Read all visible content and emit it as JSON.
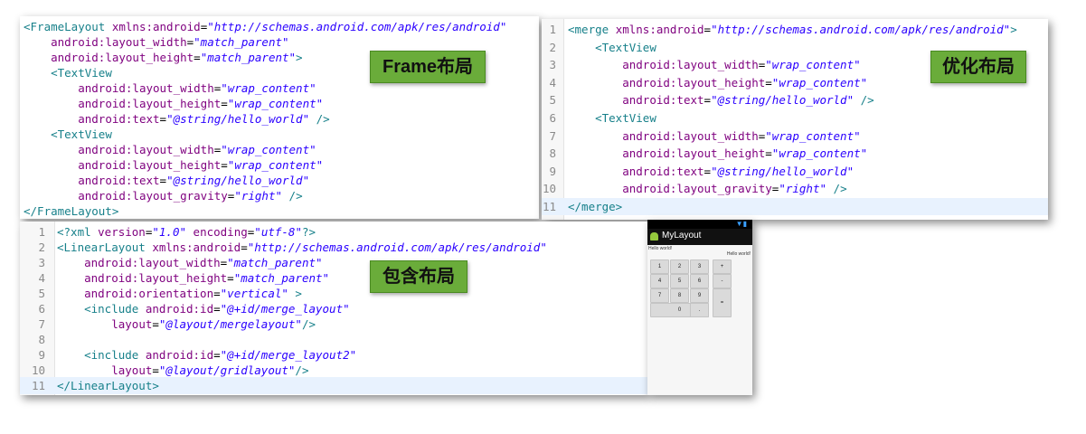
{
  "frame_panel": {
    "label": "Frame布局",
    "lines": [
      [
        [
          "tag",
          "<FrameLayout "
        ],
        [
          "attr",
          "xmlns:android"
        ],
        [
          "plain",
          "="
        ],
        [
          "val",
          "\"http://schemas.android.com/apk/res/android\""
        ]
      ],
      [
        [
          "plain",
          "    "
        ],
        [
          "attr",
          "android:layout_width"
        ],
        [
          "plain",
          "="
        ],
        [
          "val",
          "\"match_parent\""
        ]
      ],
      [
        [
          "plain",
          "    "
        ],
        [
          "attr",
          "android:layout_height"
        ],
        [
          "plain",
          "="
        ],
        [
          "val",
          "\"match_parent\""
        ],
        [
          "tag",
          ">"
        ]
      ],
      [
        [
          "plain",
          "    "
        ],
        [
          "tag",
          "<TextView"
        ]
      ],
      [
        [
          "plain",
          "        "
        ],
        [
          "attr",
          "android:layout_width"
        ],
        [
          "plain",
          "="
        ],
        [
          "val",
          "\"wrap_content\""
        ]
      ],
      [
        [
          "plain",
          "        "
        ],
        [
          "attr",
          "android:layout_height"
        ],
        [
          "plain",
          "="
        ],
        [
          "val",
          "\"wrap_content\""
        ]
      ],
      [
        [
          "plain",
          "        "
        ],
        [
          "attr",
          "android:text"
        ],
        [
          "plain",
          "="
        ],
        [
          "val",
          "\"@string/hello_world\""
        ],
        [
          "tag",
          " />"
        ]
      ],
      [
        [
          "plain",
          "    "
        ],
        [
          "tag",
          "<TextView"
        ]
      ],
      [
        [
          "plain",
          "        "
        ],
        [
          "attr",
          "android:layout_width"
        ],
        [
          "plain",
          "="
        ],
        [
          "val",
          "\"wrap_content\""
        ]
      ],
      [
        [
          "plain",
          "        "
        ],
        [
          "attr",
          "android:layout_height"
        ],
        [
          "plain",
          "="
        ],
        [
          "val",
          "\"wrap_content\""
        ]
      ],
      [
        [
          "plain",
          "        "
        ],
        [
          "attr",
          "android:text"
        ],
        [
          "plain",
          "="
        ],
        [
          "val",
          "\"@string/hello_world\""
        ]
      ],
      [
        [
          "plain",
          "        "
        ],
        [
          "attr",
          "android:layout_gravity"
        ],
        [
          "plain",
          "="
        ],
        [
          "val",
          "\"right\""
        ],
        [
          "tag",
          " />"
        ]
      ],
      [
        [
          "tag",
          "</FrameLayout>"
        ]
      ]
    ]
  },
  "merge_panel": {
    "label": "优化布局",
    "lines": [
      {
        "n": "1",
        "t": [
          [
            "tag",
            "<merge "
          ],
          [
            "attr",
            "xmlns:android"
          ],
          [
            "plain",
            "="
          ],
          [
            "val",
            "\"http://schemas.android.com/apk/res/android\""
          ],
          [
            "tag",
            ">"
          ]
        ]
      },
      {
        "n": "2",
        "t": [
          [
            "plain",
            "    "
          ],
          [
            "tag",
            "<TextView"
          ]
        ]
      },
      {
        "n": "3",
        "t": [
          [
            "plain",
            "        "
          ],
          [
            "attr",
            "android:layout_width"
          ],
          [
            "plain",
            "="
          ],
          [
            "val",
            "\"wrap_content\""
          ]
        ]
      },
      {
        "n": "4",
        "t": [
          [
            "plain",
            "        "
          ],
          [
            "attr",
            "android:layout_height"
          ],
          [
            "plain",
            "="
          ],
          [
            "val",
            "\"wrap_content\""
          ]
        ]
      },
      {
        "n": "5",
        "t": [
          [
            "plain",
            "        "
          ],
          [
            "attr",
            "android:text"
          ],
          [
            "plain",
            "="
          ],
          [
            "val",
            "\"@string/hello_world\""
          ],
          [
            "tag",
            " />"
          ]
        ]
      },
      {
        "n": "6",
        "t": [
          [
            "plain",
            "    "
          ],
          [
            "tag",
            "<TextView"
          ]
        ]
      },
      {
        "n": "7",
        "t": [
          [
            "plain",
            "        "
          ],
          [
            "attr",
            "android:layout_width"
          ],
          [
            "plain",
            "="
          ],
          [
            "val",
            "\"wrap_content\""
          ]
        ]
      },
      {
        "n": "8",
        "t": [
          [
            "plain",
            "        "
          ],
          [
            "attr",
            "android:layout_height"
          ],
          [
            "plain",
            "="
          ],
          [
            "val",
            "\"wrap_content\""
          ]
        ]
      },
      {
        "n": "9",
        "t": [
          [
            "plain",
            "        "
          ],
          [
            "attr",
            "android:text"
          ],
          [
            "plain",
            "="
          ],
          [
            "val",
            "\"@string/hello_world\""
          ]
        ]
      },
      {
        "n": "10",
        "t": [
          [
            "plain",
            "        "
          ],
          [
            "attr",
            "android:layout_gravity"
          ],
          [
            "plain",
            "="
          ],
          [
            "val",
            "\"right\""
          ],
          [
            "tag",
            " />"
          ]
        ]
      },
      {
        "n": "11",
        "t": [
          [
            "tag",
            "</merge>"
          ]
        ]
      }
    ]
  },
  "include_panel": {
    "label": "包含布局",
    "lines": [
      {
        "n": "1",
        "t": [
          [
            "tag",
            "<?xml "
          ],
          [
            "attr",
            "version"
          ],
          [
            "plain",
            "="
          ],
          [
            "val",
            "\"1.0\""
          ],
          [
            "plain",
            " "
          ],
          [
            "attr",
            "encoding"
          ],
          [
            "plain",
            "="
          ],
          [
            "val",
            "\"utf-8\""
          ],
          [
            "tag",
            "?>"
          ]
        ]
      },
      {
        "n": "2",
        "t": [
          [
            "tag",
            "<LinearLayout "
          ],
          [
            "attr",
            "xmlns:android"
          ],
          [
            "plain",
            "="
          ],
          [
            "val",
            "\"http://schemas.android.com/apk/res/android\""
          ]
        ]
      },
      {
        "n": "3",
        "t": [
          [
            "plain",
            "    "
          ],
          [
            "attr",
            "android:layout_width"
          ],
          [
            "plain",
            "="
          ],
          [
            "val",
            "\"match_parent\""
          ]
        ]
      },
      {
        "n": "4",
        "t": [
          [
            "plain",
            "    "
          ],
          [
            "attr",
            "android:layout_height"
          ],
          [
            "plain",
            "="
          ],
          [
            "val",
            "\"match_parent\""
          ]
        ]
      },
      {
        "n": "5",
        "t": [
          [
            "plain",
            "    "
          ],
          [
            "attr",
            "android:orientation"
          ],
          [
            "plain",
            "="
          ],
          [
            "val",
            "\"vertical\""
          ],
          [
            "tag",
            " >"
          ]
        ]
      },
      {
        "n": "6",
        "t": [
          [
            "plain",
            "    "
          ],
          [
            "tag",
            "<include "
          ],
          [
            "attr",
            "android:id"
          ],
          [
            "plain",
            "="
          ],
          [
            "val",
            "\"@+id/merge_layout\""
          ]
        ]
      },
      {
        "n": "7",
        "t": [
          [
            "plain",
            "        "
          ],
          [
            "attr",
            "layout"
          ],
          [
            "plain",
            "="
          ],
          [
            "val",
            "\"@layout/mergelayout\""
          ],
          [
            "tag",
            "/>"
          ]
        ]
      },
      {
        "n": "8",
        "t": []
      },
      {
        "n": "9",
        "t": [
          [
            "plain",
            "    "
          ],
          [
            "tag",
            "<include "
          ],
          [
            "attr",
            "android:id"
          ],
          [
            "plain",
            "="
          ],
          [
            "val",
            "\"@+id/merge_layout2\""
          ]
        ]
      },
      {
        "n": "10",
        "t": [
          [
            "plain",
            "        "
          ],
          [
            "attr",
            "layout"
          ],
          [
            "plain",
            "="
          ],
          [
            "val",
            "\"@layout/gridlayout\""
          ],
          [
            "tag",
            "/>"
          ]
        ]
      },
      {
        "n": "11",
        "t": [
          [
            "tag",
            "</LinearLayout>"
          ]
        ]
      }
    ]
  },
  "phone": {
    "app_title": "MyLayout",
    "hello_left": "Hello world!",
    "hello_right": "Hello world!",
    "keys": [
      "1",
      "2",
      "3",
      "+",
      "4",
      "5",
      "6",
      "-",
      "7",
      "8",
      "9",
      "0",
      ".",
      "="
    ]
  },
  "colors": {
    "tag": "#17808a",
    "attribute": "#7f007f",
    "value": "#2a00ff",
    "label_bg": "#6aac3a",
    "current_line": "#e8f2fe"
  }
}
